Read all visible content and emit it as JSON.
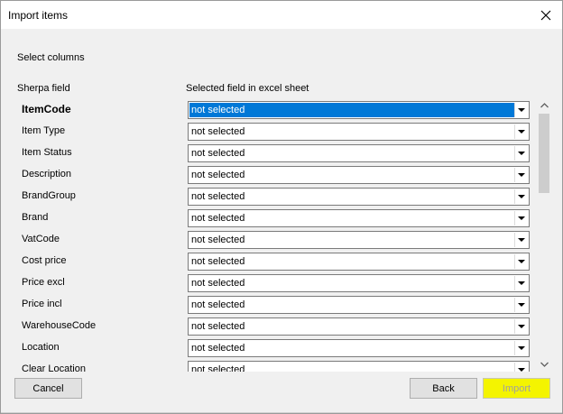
{
  "window": {
    "title": "Import items"
  },
  "section_label": "Select columns",
  "columns": {
    "field_header": "Sherpa field",
    "excel_header": "Selected field in excel sheet"
  },
  "rows": [
    {
      "field": "ItemCode",
      "value": "not selected",
      "bold": true,
      "focused": true
    },
    {
      "field": "Item Type",
      "value": "not selected"
    },
    {
      "field": "Item Status",
      "value": "not selected"
    },
    {
      "field": "Description",
      "value": "not selected"
    },
    {
      "field": "BrandGroup",
      "value": "not selected"
    },
    {
      "field": "Brand",
      "value": "not selected"
    },
    {
      "field": "VatCode",
      "value": "not selected"
    },
    {
      "field": "Cost price",
      "value": "not selected"
    },
    {
      "field": "Price excl",
      "value": "not selected"
    },
    {
      "field": "Price incl",
      "value": "not selected"
    },
    {
      "field": "WarehouseCode",
      "value": "not selected"
    },
    {
      "field": "Location",
      "value": "not selected"
    },
    {
      "field": "Clear Location",
      "value": "not selected"
    }
  ],
  "buttons": {
    "cancel": "Cancel",
    "back": "Back",
    "import": "Import"
  },
  "colors": {
    "selection": "#0078d7",
    "import_highlight": "#f4f400",
    "window_bg": "#f0f0f0"
  },
  "icons": {
    "close": "close-icon",
    "combo_arrow": "chevron-down-icon",
    "scroll_up": "scroll-up-icon",
    "scroll_down": "scroll-down-icon"
  }
}
